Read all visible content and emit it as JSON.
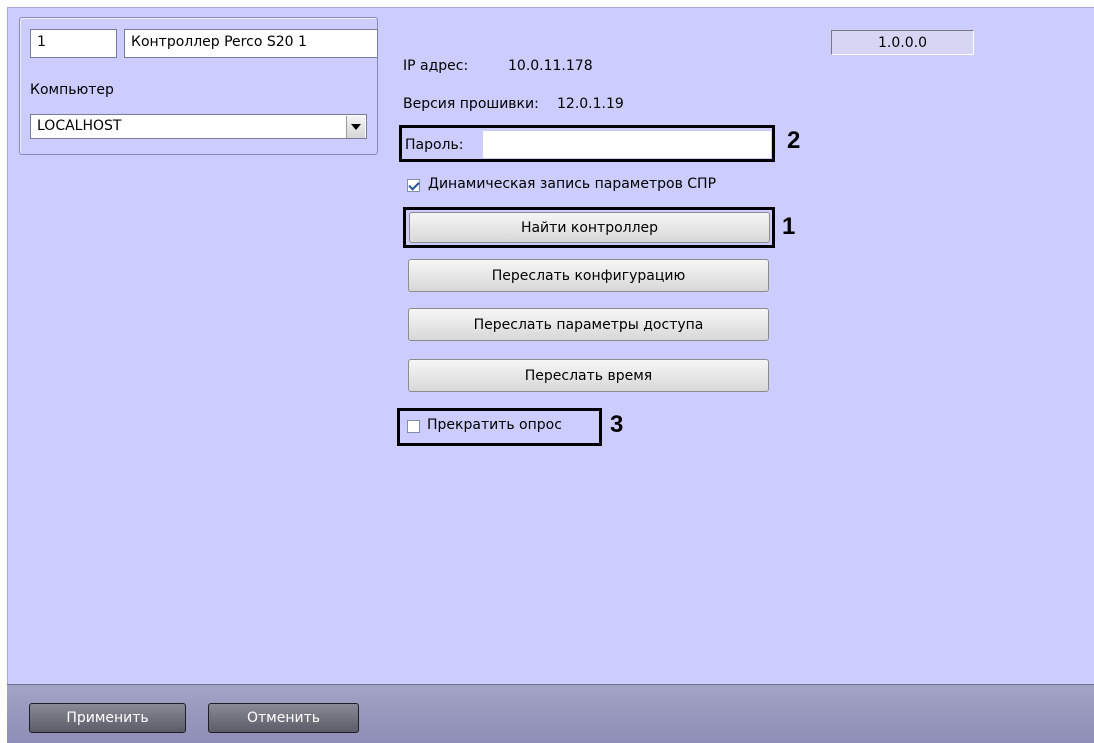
{
  "device": {
    "id_value": "1",
    "name_value": "Контроллер Perco S20 1",
    "computer_label": "Компьютер",
    "computer_value": "LOCALHOST"
  },
  "info": {
    "ip_label": "IP адрес:",
    "ip_value": "10.0.11.178",
    "firmware_label": "Версия прошивки:",
    "firmware_value": "12.0.1.19",
    "version_value": "1.0.0.0"
  },
  "password": {
    "label": "Пароль:",
    "value": ""
  },
  "dynamic_write": {
    "label": "Динамическая запись параметров СПР",
    "checked": true
  },
  "buttons": {
    "find": "Найти контроллер",
    "send_config": "Переслать конфигурацию",
    "send_access": "Переслать параметры доступа",
    "send_time": "Переслать время"
  },
  "stop_polling": {
    "label": "Прекратить опрос",
    "checked": false
  },
  "callouts": {
    "one": "1",
    "two": "2",
    "three": "3"
  },
  "footer": {
    "apply": "Применить",
    "cancel": "Отменить"
  },
  "colors": {
    "panel_bg": "#ccccff",
    "footer_bg": "#9999c0",
    "highlight": "#000000"
  },
  "icons": {
    "combo_arrow": "chevron-down-icon",
    "checkbox_checked": "checkmark-icon"
  }
}
